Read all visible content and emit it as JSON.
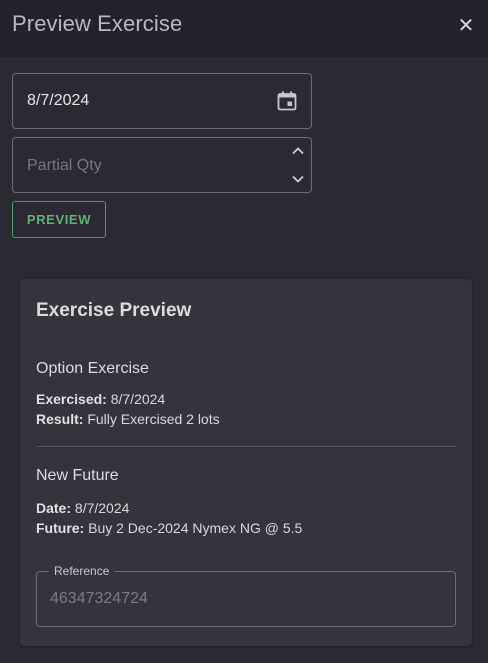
{
  "dialog": {
    "title": "Preview Exercise",
    "close_icon": "close-icon"
  },
  "form": {
    "date_value": "8/7/2024",
    "calendar_icon": "calendar-icon",
    "qty_placeholder": "Partial Qty",
    "preview_button_label": "PREVIEW"
  },
  "preview": {
    "title": "Exercise Preview",
    "option_exercise": {
      "heading": "Option Exercise",
      "exercised_label": "Exercised:",
      "exercised_value": "8/7/2024",
      "result_label": "Result:",
      "result_value": "Fully Exercised 2 lots"
    },
    "new_future": {
      "heading": "New Future",
      "date_label": "Date:",
      "date_value": "8/7/2024",
      "future_label": "Future:",
      "future_value": "Buy 2 Dec-2024 Nymex NG @ 5.5"
    },
    "reference": {
      "label": "Reference",
      "value": "46347324724"
    }
  },
  "colors": {
    "background": "#2b2a33",
    "titlebar": "#23222a",
    "card": "#35343c",
    "accent_green": "#5fb274"
  }
}
